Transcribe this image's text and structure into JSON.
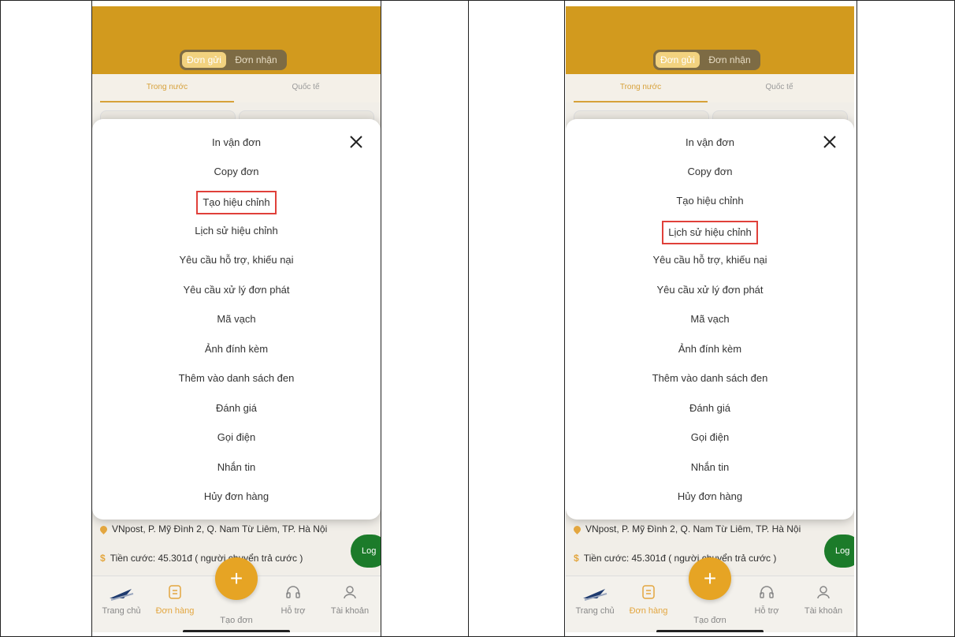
{
  "segmented": [
    "Đơn gửi",
    "Đơn nhận"
  ],
  "tabs": [
    "Trong nước",
    "Quốc tế"
  ],
  "menu": [
    "In vận đơn",
    "Copy đơn",
    "Tạo hiệu chỉnh",
    "Lịch sử hiệu chỉnh",
    "Yêu cầu hỗ trợ, khiếu nại",
    "Yêu cầu xử lý đơn phát",
    "Mã vạch",
    "Ảnh đính kèm",
    "Thêm vào danh sách đen",
    "Đánh giá",
    "Gọi điện",
    "Nhắn tin",
    "Hủy đơn hàng"
  ],
  "address": "VNpost, P. Mỹ Đình 2, Q. Nam Từ Liêm, TP. Hà Nội",
  "fee": "Tiền cước: 45.301đ ( người chuyển trả cước )",
  "log_label": "Log",
  "nav": [
    "Trang chủ",
    "Đơn hàng",
    "Tạo đơn",
    "Hỗ trợ",
    "Tài khoản"
  ],
  "fab_symbol": "+",
  "colors": {
    "header": "#d29a1e",
    "accent": "#e3a63f",
    "highlight": "#e0403a",
    "log": "#1c7b2a"
  },
  "panels": [
    {
      "highlighted": "Tạo hiệu chỉnh"
    },
    {
      "highlighted": "Lịch sử hiệu chỉnh"
    }
  ]
}
